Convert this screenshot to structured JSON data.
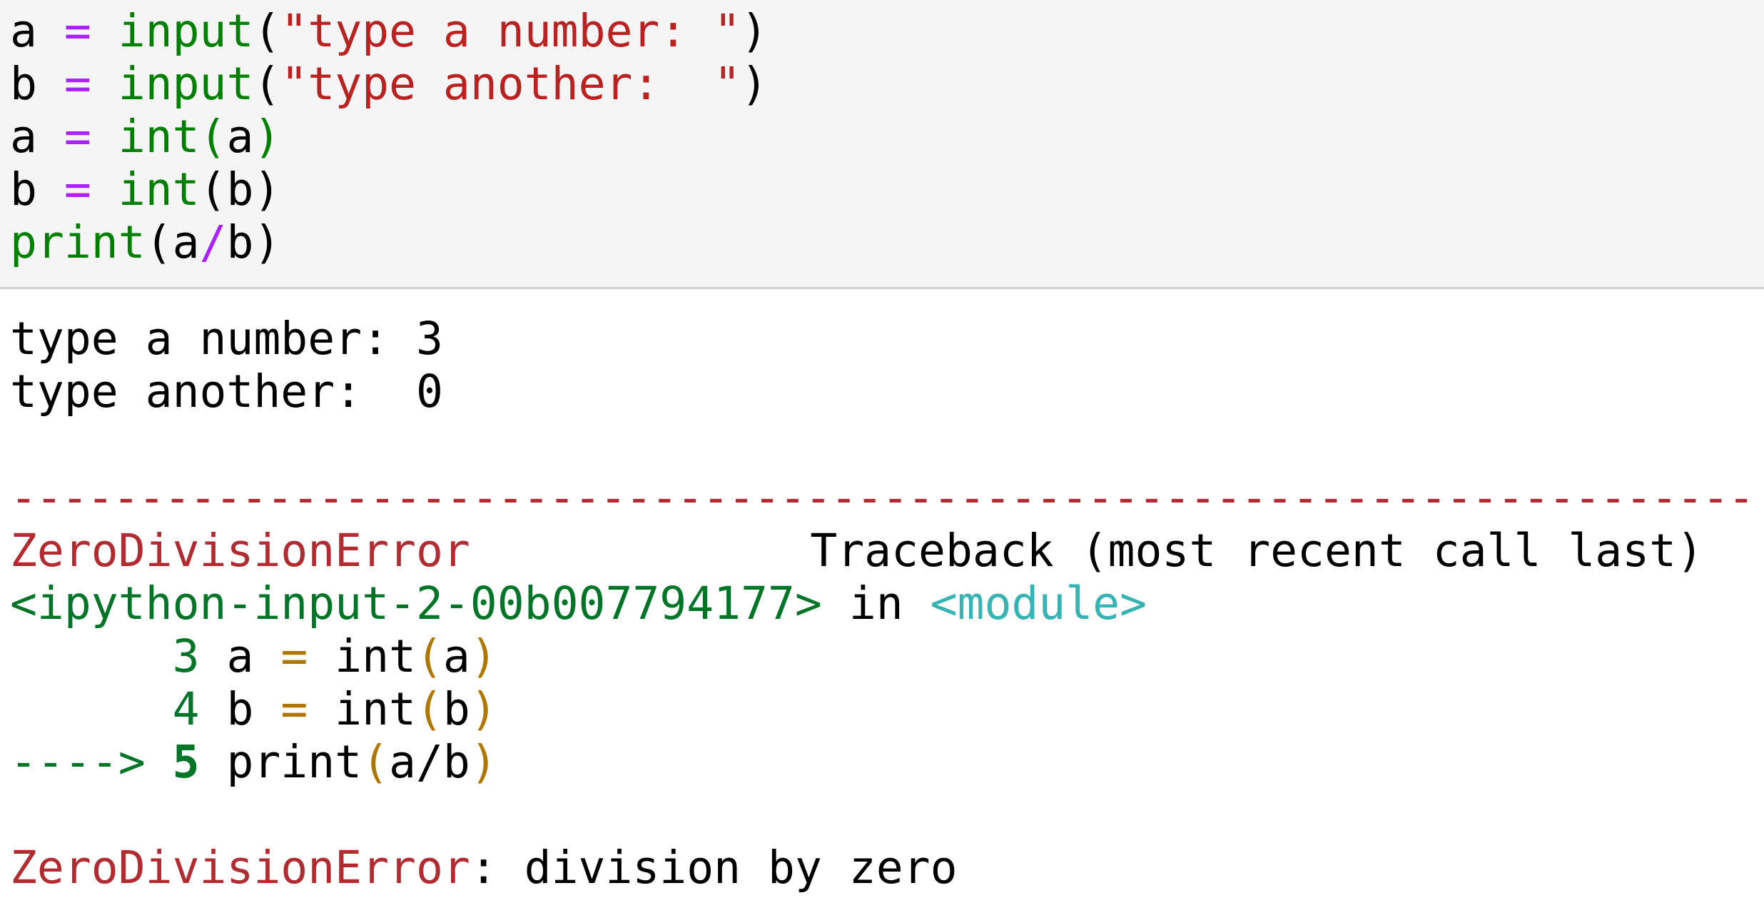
{
  "code_cell": {
    "lines": [
      {
        "var": "a",
        "op": "=",
        "fn": "input",
        "open": "(",
        "str": "\"type a number: \"",
        "close": ")"
      },
      {
        "var": "b",
        "op": "=",
        "fn": "input",
        "open": "(",
        "str": "\"type another:  \"",
        "close": ")"
      },
      {
        "var": "a",
        "op": "=",
        "fn": "int",
        "open": "(",
        "arg": "a",
        "close": ")"
      },
      {
        "var": "b",
        "op": "=",
        "fn": "int",
        "open": "(",
        "arg": "b",
        "close": ")"
      },
      {
        "fn": "print",
        "open": "(",
        "arg1": "a",
        "op": "/",
        "arg2": "b",
        "close": ")"
      }
    ]
  },
  "output": {
    "stdin_lines": [
      "type a number: 3",
      "type another:  0"
    ],
    "separator": "-----------------------------------------------------------------------------------------------------------------------------------",
    "traceback": {
      "error_name": "ZeroDivisionError",
      "header_right": "Traceback (most recent call last)",
      "location_file": "<ipython-input-2-00b007794177>",
      "location_in": " in ",
      "location_module": "<module>",
      "frames": [
        {
          "prefix": "      ",
          "lineno": "3",
          "code_pre": " a ",
          "eq": "=",
          "code_mid": " int",
          "open": "(",
          "arg": "a",
          "close": ")"
        },
        {
          "prefix": "      ",
          "lineno": "4",
          "code_pre": " b ",
          "eq": "=",
          "code_mid": " int",
          "open": "(",
          "arg": "b",
          "close": ")"
        },
        {
          "prefix": "---->",
          "lineno": " 5",
          "code_pre": " print",
          "open": "(",
          "arg": "a/b",
          "close": ")"
        }
      ],
      "final_error_name": "ZeroDivisionError",
      "final_message": ": division by zero"
    }
  }
}
